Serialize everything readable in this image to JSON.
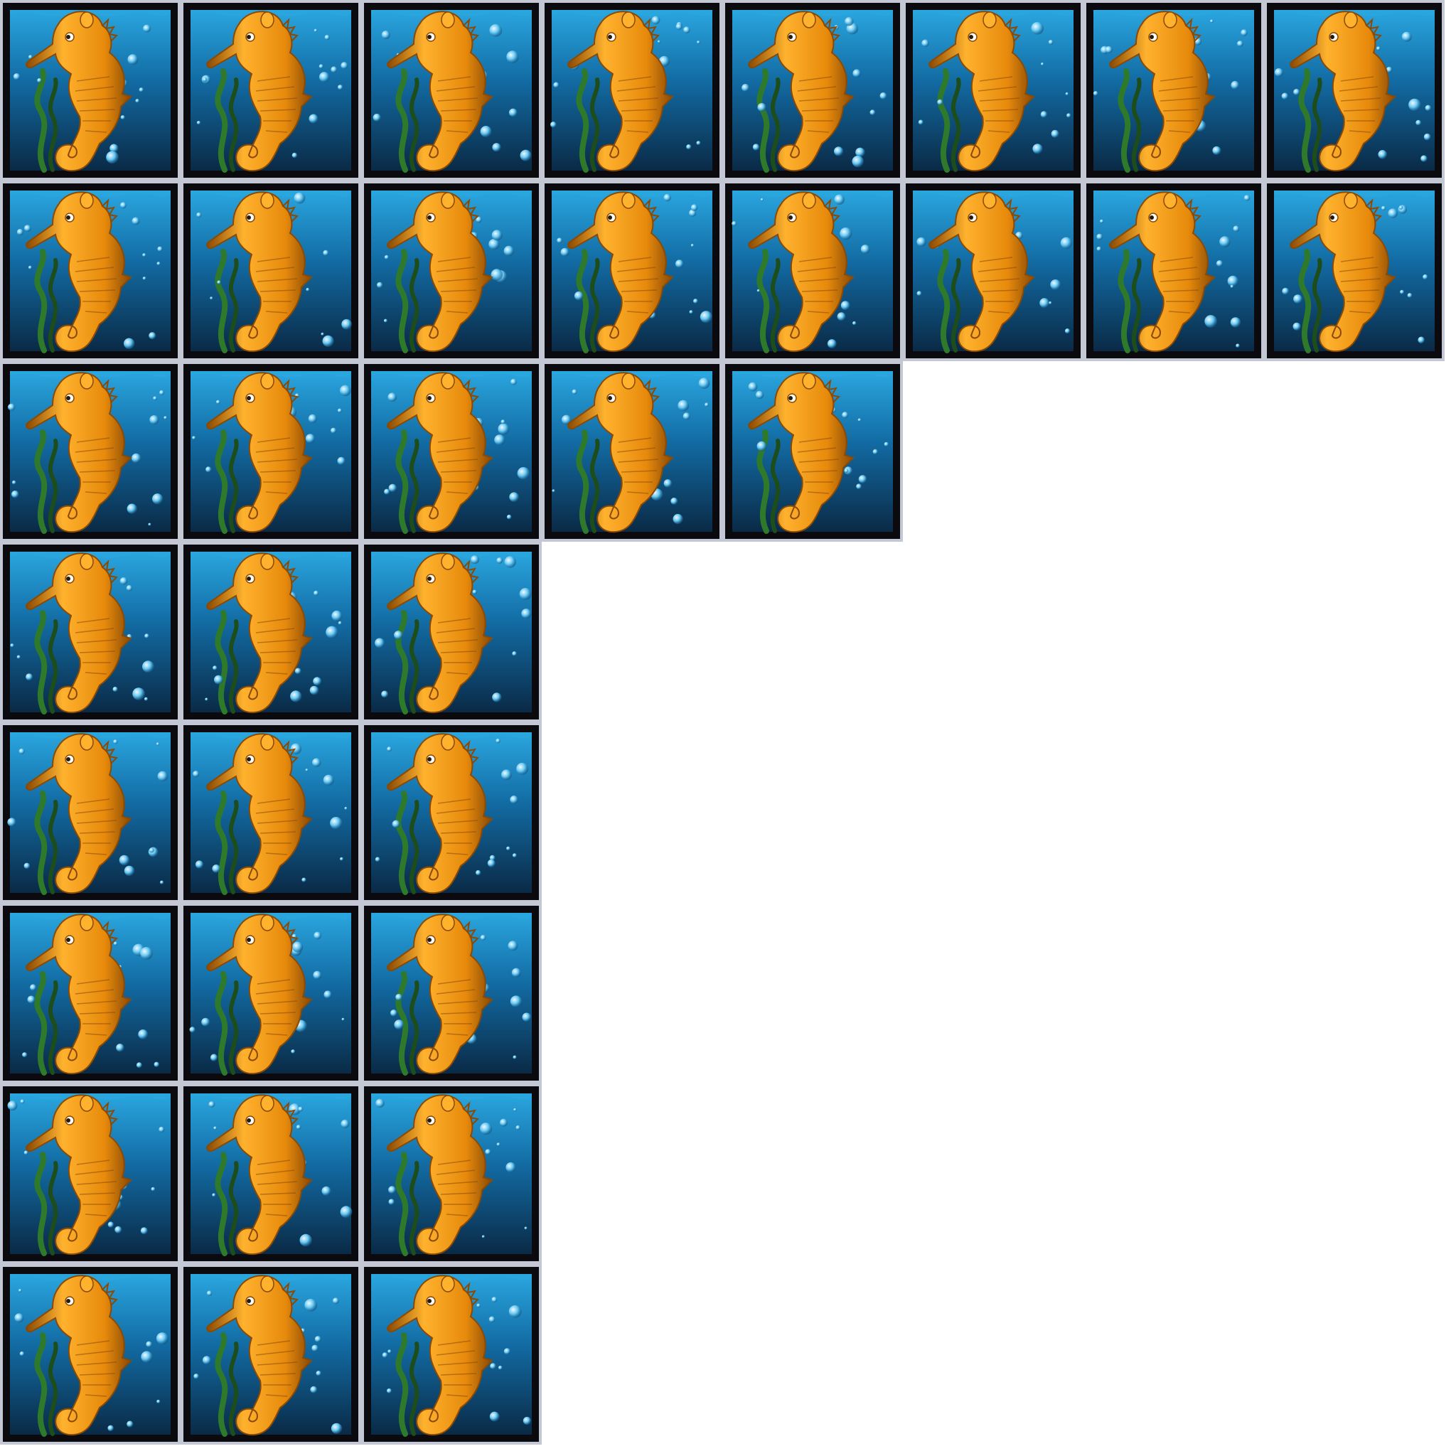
{
  "sheet": {
    "rows": [
      8,
      8,
      5,
      3,
      3,
      3,
      3,
      3
    ]
  },
  "tile": {
    "icon": "seahorse-icon",
    "colors": {
      "frame": "#0a0a0f",
      "border": "#c4c8d4",
      "water_top": "#2aa6df",
      "water_mid": "#126aa2",
      "water_bottom": "#0a2a46",
      "seahorse_light": "#ffb22e",
      "seahorse_mid": "#e78a0c",
      "seahorse_dark": "#8a4a05",
      "seaweed": "#2f7a2a",
      "seaweed_dark": "#1d4d1a",
      "bubble": "#63c8f4"
    }
  }
}
